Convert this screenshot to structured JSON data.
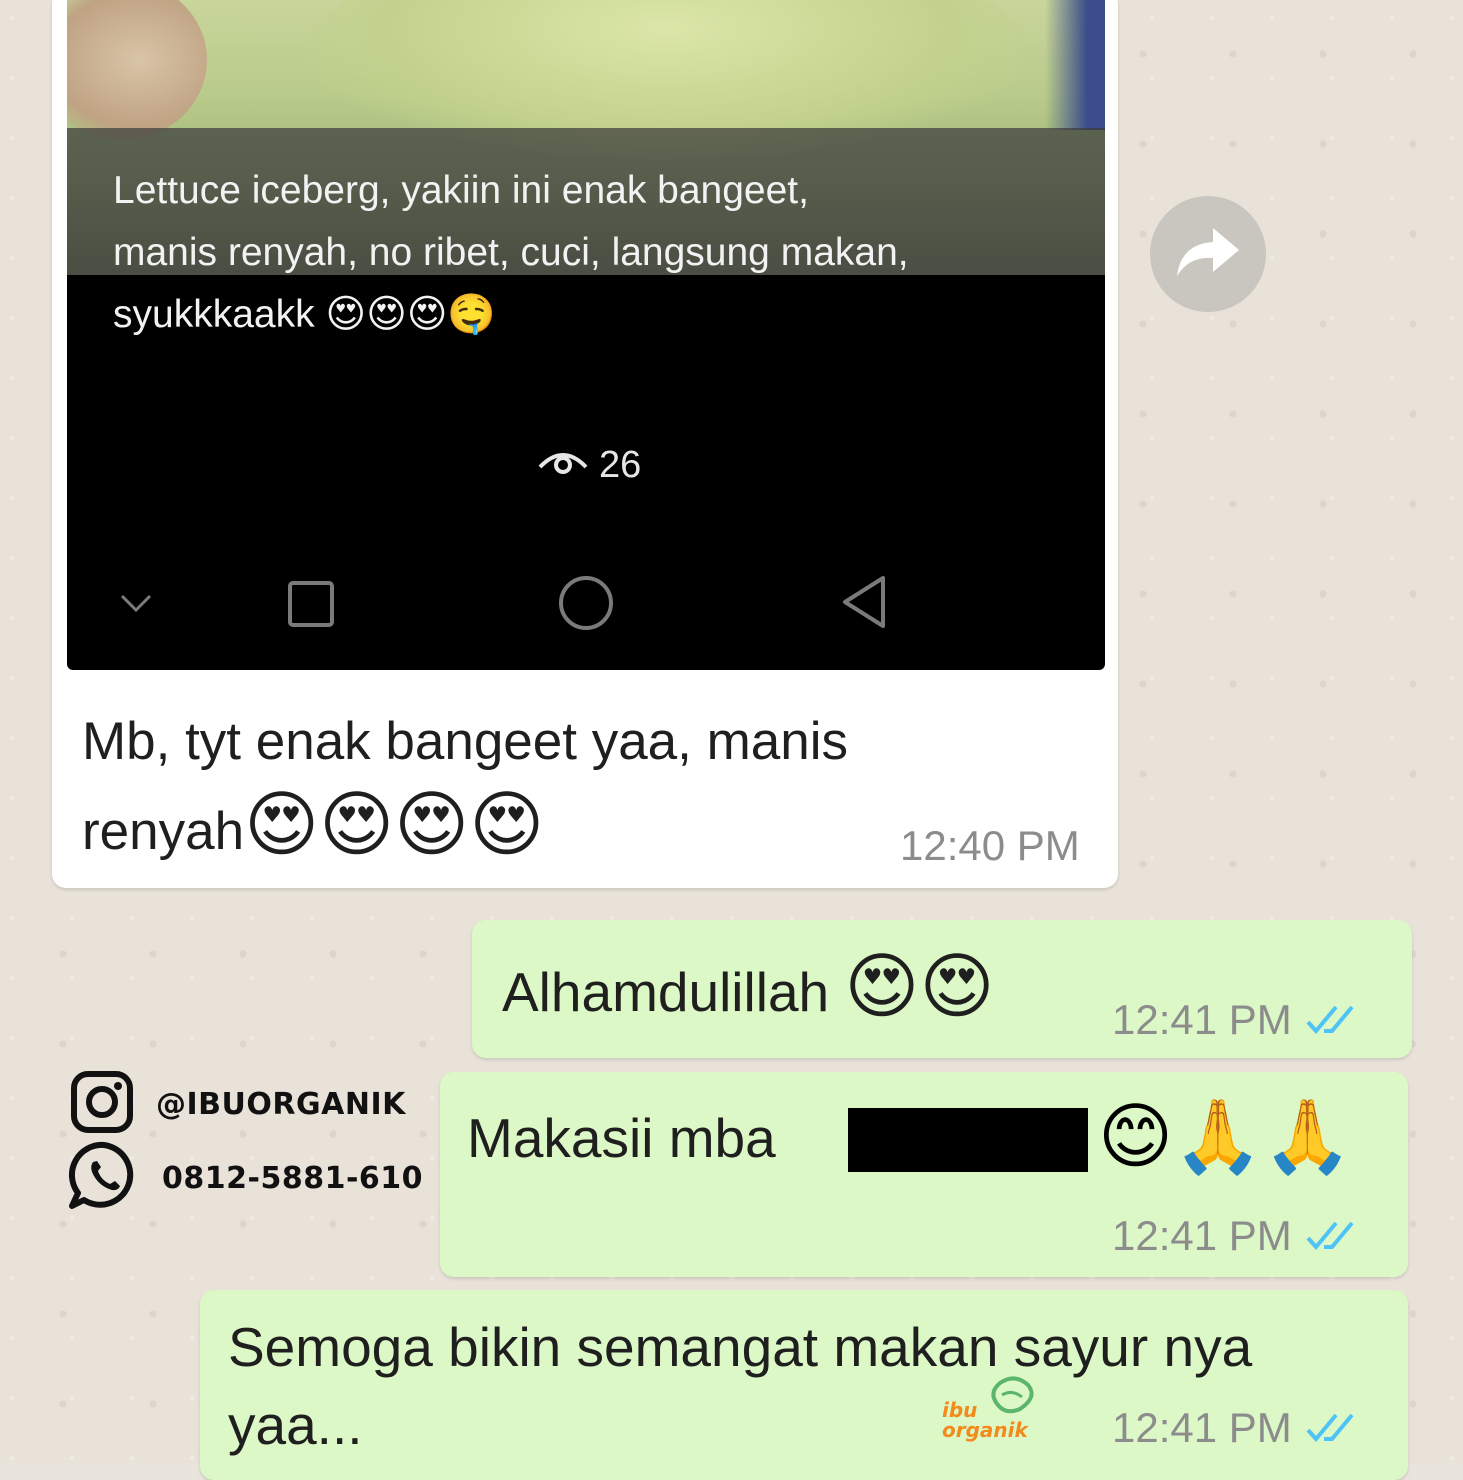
{
  "status_post": {
    "caption": "Lettuce iceberg, yakiin ini enak bangeet,\nmanis renyah, no ribet, cuci, langsung makan,\nsyukkkaakk",
    "caption_emoji": "😍😍😍🤤",
    "views": "26"
  },
  "messages": [
    {
      "text": "Mb, tyt enak bangeet yaa, manis renyah",
      "emoji": "😍😍😍😍",
      "time": "12:40 PM"
    },
    {
      "text": "Alhamdulillah",
      "emoji": "😍😍",
      "time": "12:41 PM"
    },
    {
      "text": "Makasii mba",
      "emoji": "😊🙏🙏",
      "time": "12:41 PM"
    },
    {
      "text": "Semoga bikin semangat makan sayur nya yaa...",
      "time": "12:41 PM"
    }
  ],
  "contact": {
    "instagram": "@IBUORGANIK",
    "whatsapp": "0812-5881-610"
  },
  "brand": {
    "line1": "ibu",
    "line2": "organik"
  },
  "colors": {
    "outgoing_bubble": "#dcf8c6",
    "incoming_bubble": "#ffffff",
    "read_ticks": "#4fc3f7",
    "brand_orange": "#f28a1c",
    "brand_green": "#5bb56a"
  },
  "icons": [
    "eye-icon",
    "chevron-down-icon",
    "square-icon",
    "circle-icon",
    "back-triangle-icon",
    "forward-icon",
    "double-check-icon",
    "instagram-icon",
    "whatsapp-icon"
  ]
}
